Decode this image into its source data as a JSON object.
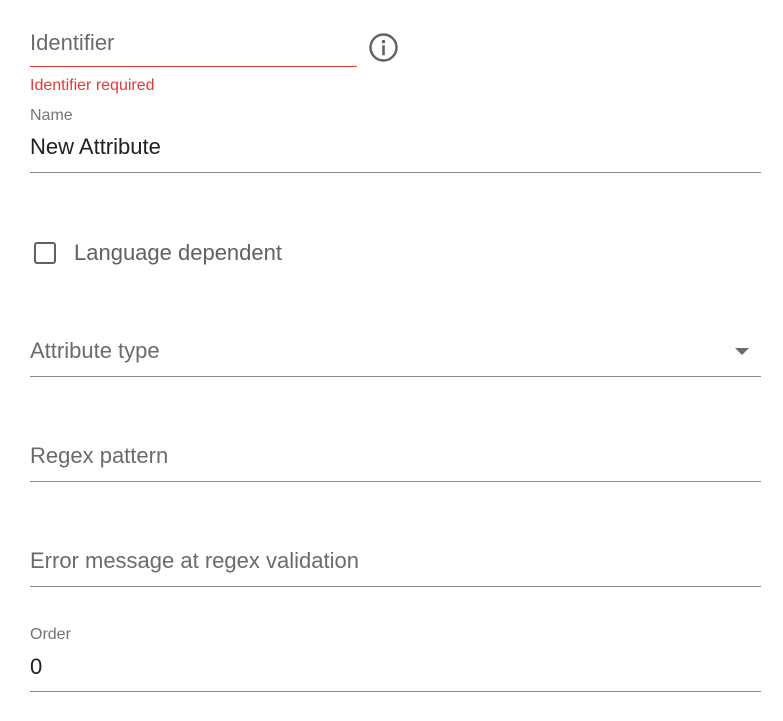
{
  "identifier": {
    "placeholder": "Identifier",
    "error": "Identifier required"
  },
  "name": {
    "label": "Name",
    "value": "New Attribute"
  },
  "language_dependent": {
    "label": "Language dependent",
    "checked": false
  },
  "attribute_type": {
    "placeholder": "Attribute type"
  },
  "regex_pattern": {
    "placeholder": "Regex pattern"
  },
  "regex_error_message": {
    "placeholder": "Error message at regex validation"
  },
  "order": {
    "label": "Order",
    "value": "0"
  },
  "colors": {
    "error": "#e53935",
    "text": "#212121",
    "muted": "#6b6b6b"
  }
}
